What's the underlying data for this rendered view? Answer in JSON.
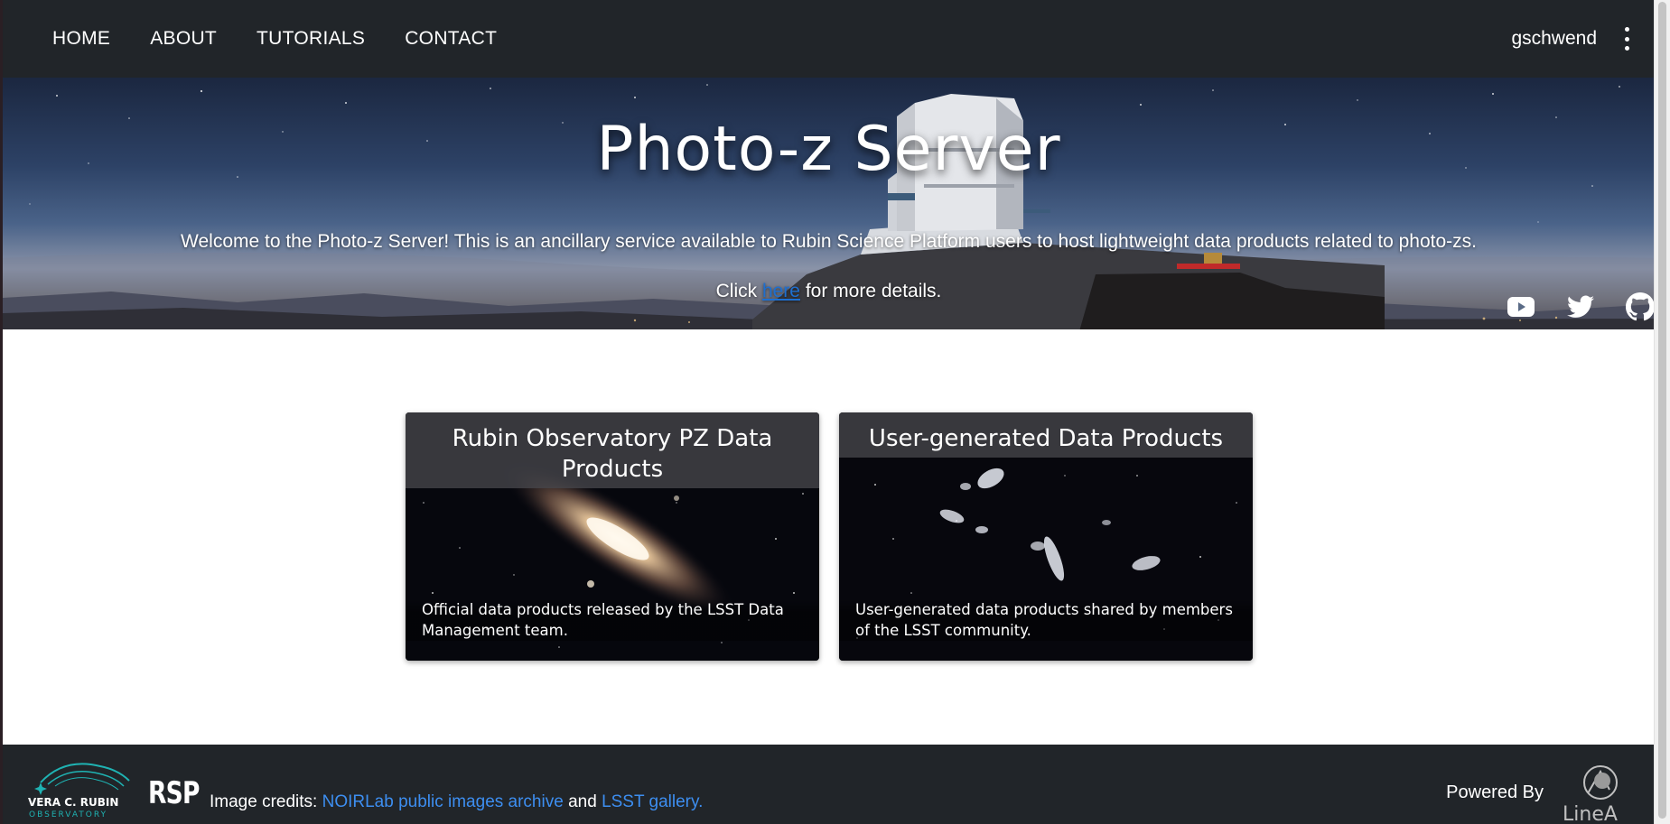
{
  "nav": {
    "items": [
      {
        "label": "HOME"
      },
      {
        "label": "ABOUT"
      },
      {
        "label": "TUTORIALS"
      },
      {
        "label": "CONTACT"
      }
    ],
    "username": "gschwend"
  },
  "hero": {
    "title": "Photo-z Server",
    "welcome": "Welcome to the Photo-z Server! This is an ancillary service available to Rubin Science Platform users to host lightweight data products related to photo-zs.",
    "click_prefix": "Click ",
    "click_link": "here",
    "click_suffix": " for more details.",
    "socials": [
      "youtube-icon",
      "twitter-icon",
      "github-icon"
    ]
  },
  "cards": [
    {
      "title": "Rubin Observatory PZ Data Products",
      "description": "Official data products released by the LSST Data Management team."
    },
    {
      "title": "User-generated Data Products",
      "description": "User-generated data products shared by members of the LSST community."
    }
  ],
  "footer": {
    "logo_text": "VERA C. RUBIN OBSERVATORY",
    "rsp_label": "RSP",
    "credits_prefix": "Image credits: ",
    "credits_link1": "NOIRLab public images archive",
    "credits_and": " and ",
    "credits_link2": "LSST gallery.",
    "powered_by": "Powered By",
    "linea_text": "LineA"
  },
  "colors": {
    "navbar": "#212529",
    "link": "#1e6fd0",
    "footer_link": "#3d8ef0",
    "rubin_teal": "#1fb3b3"
  }
}
